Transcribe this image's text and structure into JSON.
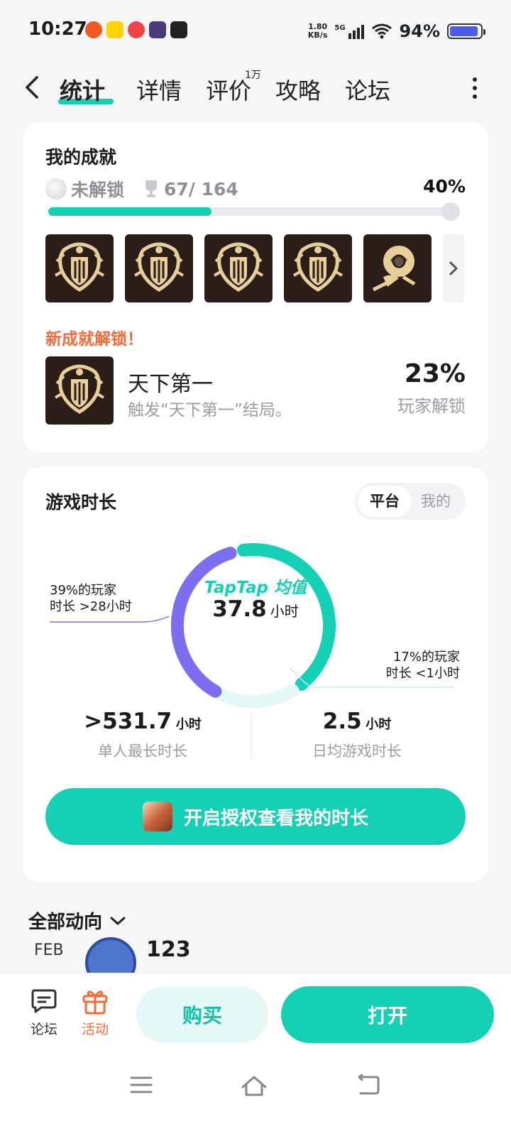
{
  "status_bar": {
    "time": "10:27",
    "net_speed_value": "1.80",
    "net_speed_unit": "KB/s",
    "network": "5G",
    "battery": "94%"
  },
  "nav": {
    "tabs": [
      {
        "label": "统计",
        "active": true
      },
      {
        "label": "详情"
      },
      {
        "label": "评价",
        "badge": "1万"
      },
      {
        "label": "攻略"
      },
      {
        "label": "论坛"
      }
    ]
  },
  "achievements": {
    "title": "我的成就",
    "unlock_label": "未解锁",
    "count": "67/ 164",
    "percent": "40%",
    "progress": 0.4,
    "new_unlock_label": "新成就解锁！",
    "featured": {
      "title": "天下第一",
      "desc": "触发“天下第一”结局。",
      "pct": "23%",
      "pct_label": "玩家解锁"
    }
  },
  "playtime": {
    "title": "游戏时长",
    "toggle": {
      "on": "平台",
      "off": "我的"
    },
    "brand": "TapTap 均值",
    "avg_value": "37.8",
    "avg_unit": "小时",
    "note_left": [
      "39%的玩家",
      "时长 >28小时"
    ],
    "note_right": [
      "17%的玩家",
      "时长 <1小时"
    ],
    "segments": {
      "over_28h": 0.39,
      "under_1h": 0.17
    },
    "stats": [
      {
        "prefix": ">",
        "value": "531.7",
        "unit": "小时",
        "label": "单人最长时长"
      },
      {
        "prefix": "",
        "value": "2.5",
        "unit": "小时",
        "label": "日均游戏时长"
      }
    ],
    "auth_button": "开启授权查看我的时长"
  },
  "feed": {
    "title": "全部动向",
    "month": "FEB",
    "name": "123"
  },
  "bottom": {
    "forum": "论坛",
    "activity": "活动",
    "buy": "购买",
    "open": "打开"
  },
  "colors": {
    "accent": "#14d0b5",
    "purple": "#7b6ff0",
    "orange": "#f46b35",
    "badge_bg": "#2b1d18",
    "badge_gold": "#e8cf9a"
  }
}
